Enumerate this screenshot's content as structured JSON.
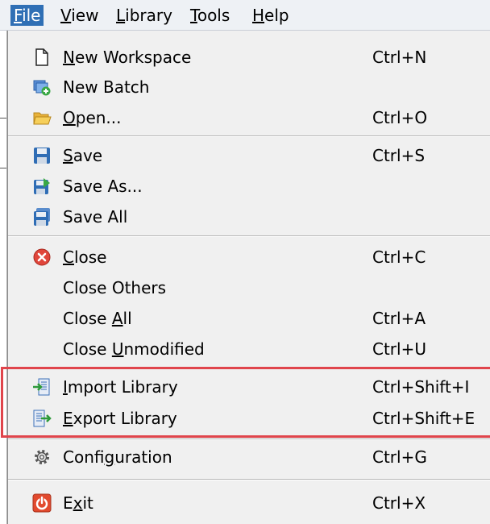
{
  "menubar": {
    "items": [
      {
        "label": "File",
        "key": "F",
        "rest": "ile"
      },
      {
        "label": "View",
        "key": "V",
        "rest": "iew"
      },
      {
        "label": "Library",
        "key": "L",
        "rest": "ibrary"
      },
      {
        "label": "Tools",
        "key": "T",
        "rest": "ools"
      },
      {
        "label": "Help",
        "key": "H",
        "rest": "elp"
      }
    ]
  },
  "menu": {
    "new_workspace": {
      "pre": "",
      "key": "N",
      "post": "ew Workspace",
      "shortcut": "Ctrl+N",
      "icon": "new-document-icon"
    },
    "new_batch": {
      "pre": "New Batch",
      "key": "",
      "post": "",
      "shortcut": "",
      "icon": "new-batch-icon"
    },
    "open": {
      "pre": "",
      "key": "O",
      "post": "pen...",
      "shortcut": "Ctrl+O",
      "icon": "folder-open-icon"
    },
    "save": {
      "pre": "",
      "key": "S",
      "post": "ave",
      "shortcut": "Ctrl+S",
      "icon": "floppy-disk-icon"
    },
    "save_as": {
      "pre": "Save As...",
      "key": "",
      "post": "",
      "shortcut": "",
      "icon": "save-as-icon"
    },
    "save_all": {
      "pre": "Save All",
      "key": "",
      "post": "",
      "shortcut": "",
      "icon": "save-all-icon"
    },
    "close": {
      "pre": "",
      "key": "C",
      "post": "lose",
      "shortcut": "Ctrl+C",
      "icon": "close-red-icon"
    },
    "close_others": {
      "pre": "Close Others",
      "key": "",
      "post": "",
      "shortcut": ""
    },
    "close_all": {
      "pre": "Close ",
      "key": "A",
      "post": "ll",
      "shortcut": "Ctrl+A"
    },
    "close_unmodified": {
      "pre": "Close ",
      "key": "U",
      "post": "nmodified",
      "shortcut": "Ctrl+U"
    },
    "import_library": {
      "pre": "",
      "key": "I",
      "post": "mport Library",
      "shortcut": "Ctrl+Shift+I",
      "icon": "import-icon"
    },
    "export_library": {
      "pre": "",
      "key": "E",
      "post": "xport Library",
      "shortcut": "Ctrl+Shift+E",
      "icon": "export-icon"
    },
    "configuration": {
      "pre": "Confi",
      "key": "g",
      "post": "uration",
      "shortcut": "Ctrl+G",
      "icon": "gear-icon"
    },
    "exit": {
      "pre": "E",
      "key": "x",
      "post": "it",
      "shortcut": "Ctrl+X",
      "icon": "power-icon"
    }
  },
  "colors": {
    "menubar_active": "#2f6fb5",
    "highlight_border": "#e0454c",
    "menu_bg": "#f0f0f0"
  }
}
